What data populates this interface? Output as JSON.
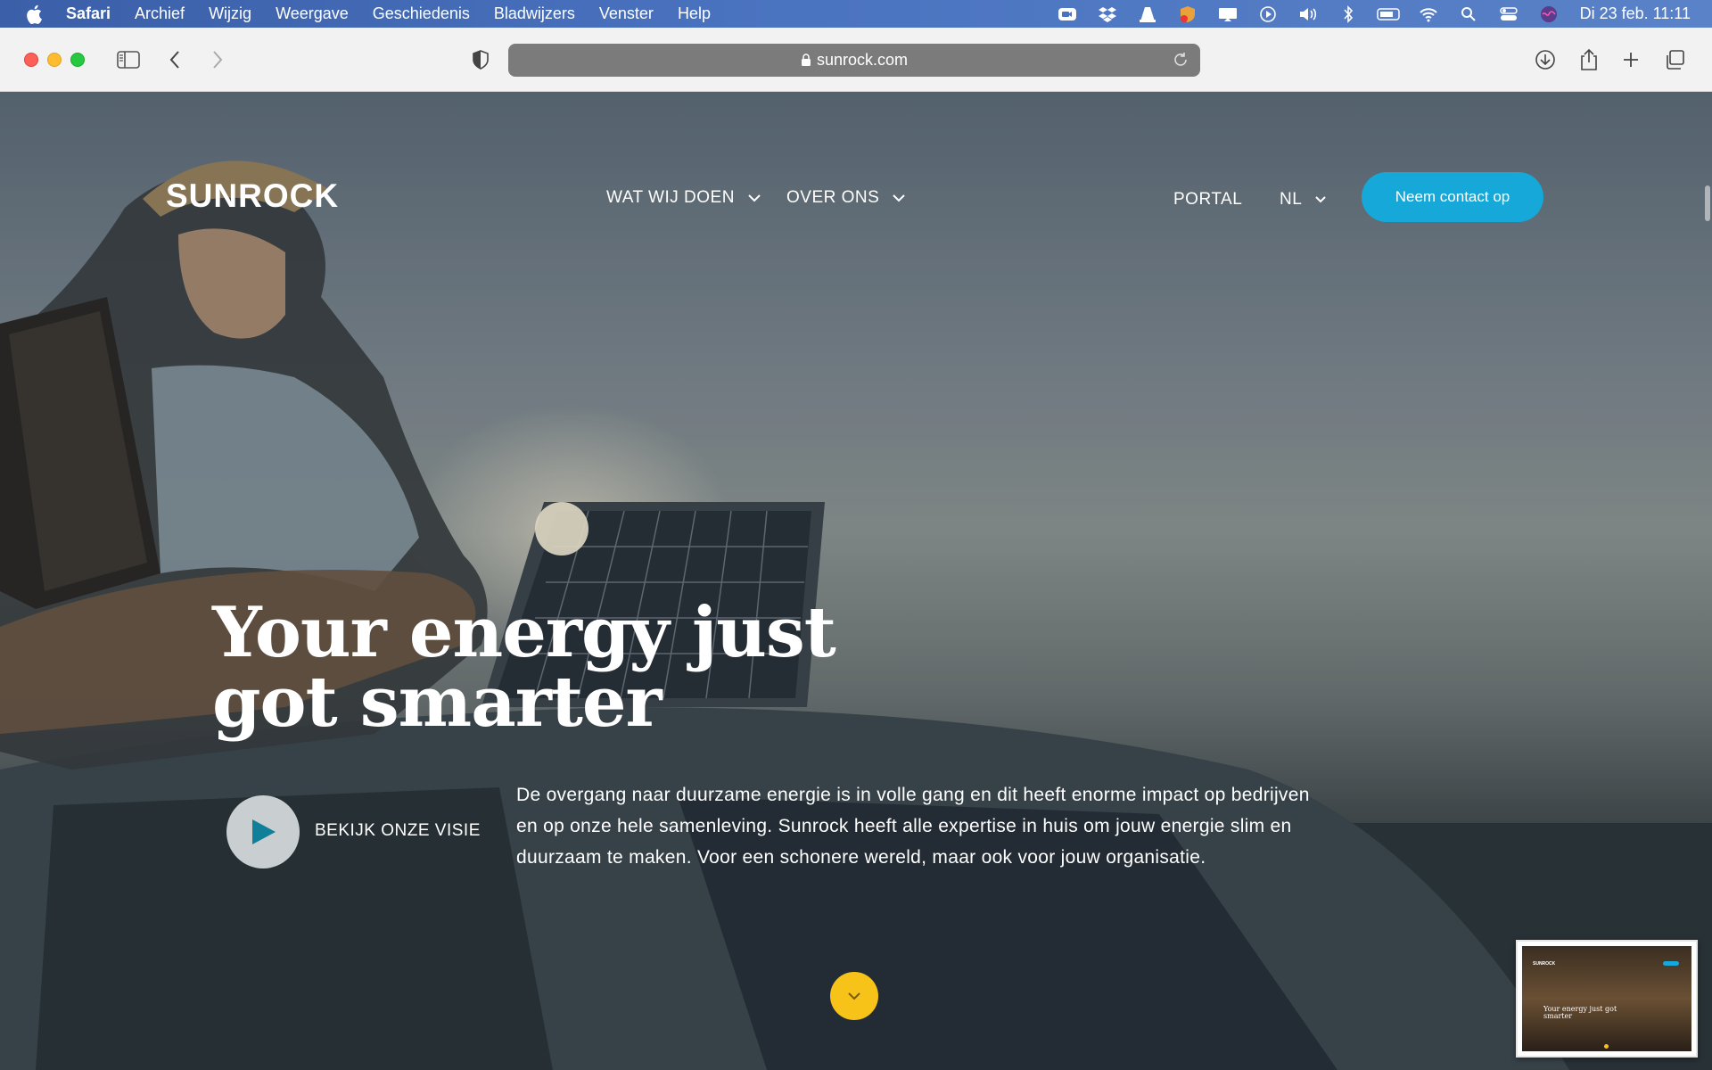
{
  "menubar": {
    "app_name": "Safari",
    "items": [
      "Archief",
      "Wijzig",
      "Weergave",
      "Geschiedenis",
      "Bladwijzers",
      "Venster",
      "Help"
    ],
    "clock": "Di 23 feb.  11:11"
  },
  "browser": {
    "url": "sunrock.com"
  },
  "site": {
    "logo": "SUNROCK",
    "nav": {
      "what_we_do": "WAT WIJ DOEN",
      "about": "OVER ONS",
      "portal": "PORTAL",
      "language": "NL"
    },
    "cta": "Neem contact op",
    "headline": "Your energy just got smarter",
    "video_label": "BEKIJK ONZE VISIE",
    "intro": "De overgang naar duurzame energie is in volle gang en dit heeft enorme impact op bedrijven en op onze hele samenleving. Sunrock heeft alle expertise in huis om jouw energie slim en duurzaam te maken. Voor een schonere wereld, maar ook voor jouw organisatie.",
    "thumbnail": {
      "logo": "SUNROCK",
      "headline": "Your energy just got smarter"
    }
  },
  "colors": {
    "accent": "#16a8d8",
    "scroll_button": "#f7c318",
    "play_icon": "#0f7f9a"
  }
}
